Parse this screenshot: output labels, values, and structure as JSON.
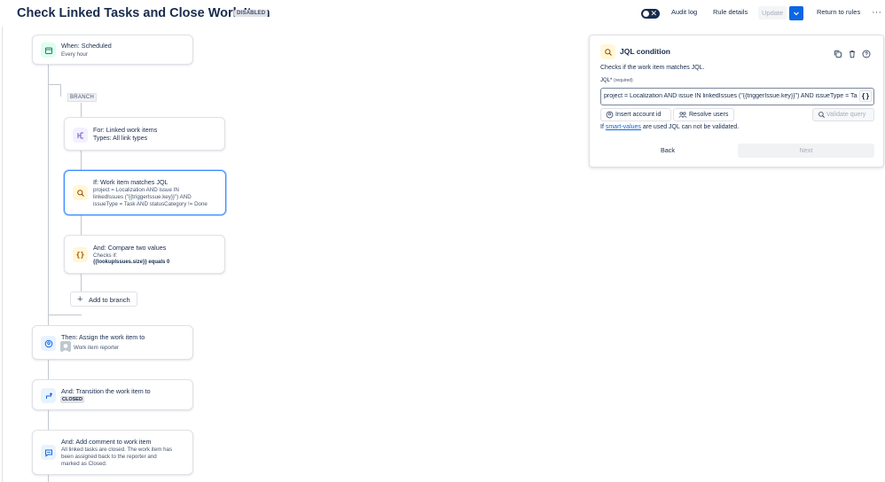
{
  "header": {
    "title": "Check Linked Tasks and Close Work Item",
    "status_badge": "DISABLED",
    "audit_log": "Audit log",
    "rule_details": "Rule details",
    "update": "Update",
    "return_to_rules": "Return to rules",
    "toggle_x": "✕",
    "more": "···"
  },
  "flow": {
    "trigger": {
      "title": "When: Scheduled",
      "subtitle": "Every hour"
    },
    "branch_label": "BRANCH",
    "branch_node": {
      "title": "For: Linked work items",
      "subtitle": "Types: All link types"
    },
    "condition_node": {
      "title": "If: Work item matches JQL",
      "line1": "project = Localization AND issue IN",
      "line2": "linkedIssues (\"{{triggerIssue.key}}\") AND",
      "line3": "issueType = Task AND statusCategory != Done"
    },
    "compare_node": {
      "title": "And: Compare two values",
      "line1": "Checks if:",
      "line2": "{{lookupIssues.size}} equals 0"
    },
    "add_to_branch": "Add to branch",
    "assign_node": {
      "title": "Then: Assign the work item to",
      "subtitle": "Work item reporter"
    },
    "transition_node": {
      "title": "And: Transition the work item to",
      "badge": "CLOSED"
    },
    "comment_node": {
      "title": "And: Add comment to work item",
      "line1": "All linked tasks are closed. The work item has",
      "line2": "been assigned back to the reporter and",
      "line3": "marked as Closed."
    }
  },
  "panel": {
    "title": "JQL condition",
    "description": "Checks if the work item matches JQL.",
    "field_label": "JQL",
    "field_required_marker": "*",
    "field_required_text": "(required)",
    "jql_value": "project = Localization AND issue IN linkedIssues (\"{{triggerIssue.key}}\") AND issueType = Task AND statusCategory != Done",
    "braces": "{}",
    "insert_account_id": "Insert account id",
    "resolve_users": "Resolve users",
    "validate_query": "Validate query",
    "note_prefix": "If ",
    "note_link": "smart-values",
    "note_suffix": " are used JQL can not be validated.",
    "back": "Back",
    "next": "Next"
  },
  "colors": {
    "selected_border": "#388bff",
    "primary_blue": "#0c66e4",
    "trigger_icon_bg": "#dcfff1",
    "branch_icon_bg": "#f3f0ff",
    "condition_icon_bg": "#fff7d6",
    "action_icon_bg": "#e9f2ff"
  }
}
